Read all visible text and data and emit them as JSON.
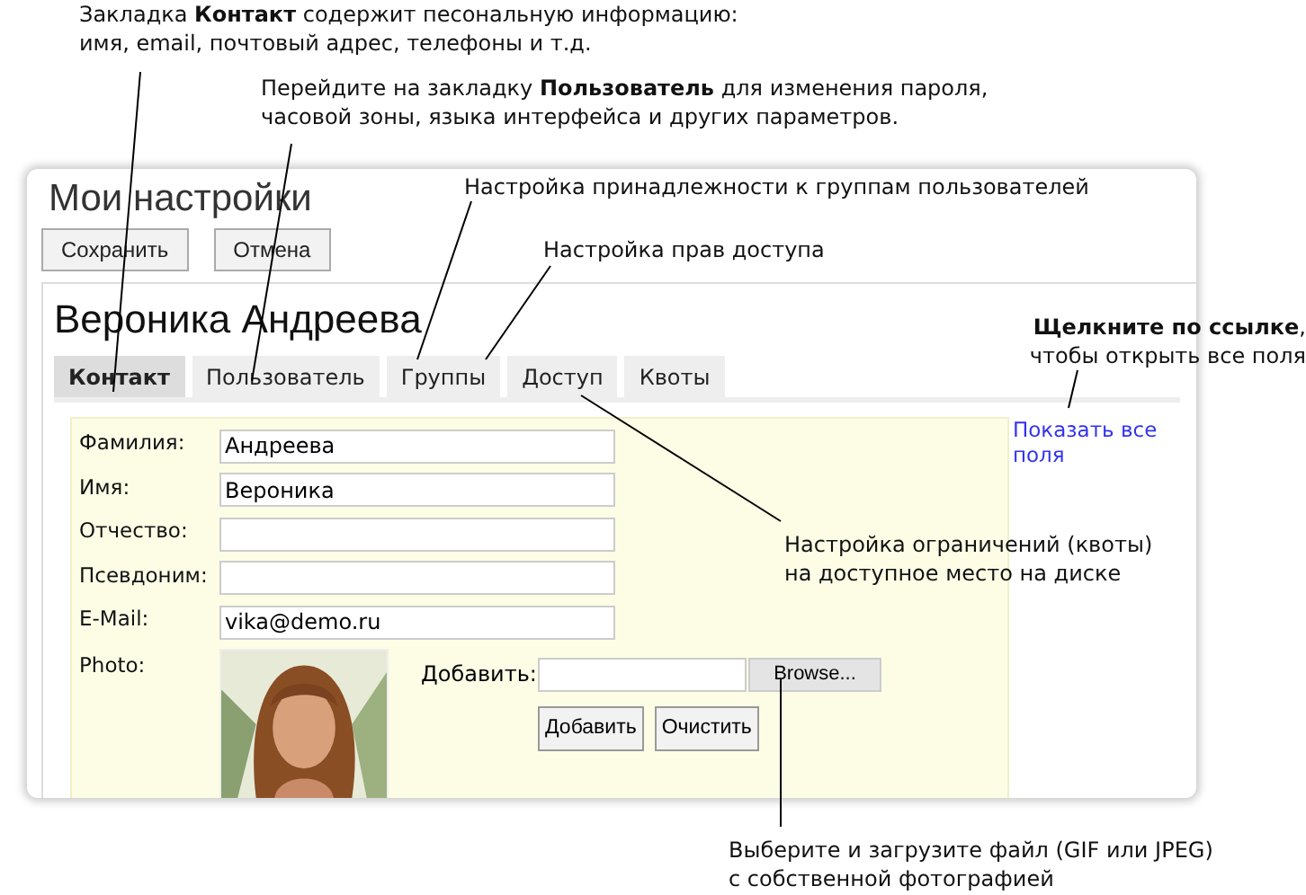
{
  "window": {
    "title": "Мои настройки",
    "buttons": [
      "Сохранить",
      "Отмена"
    ]
  },
  "profile": {
    "name": "Вероника Андреева",
    "tabs": [
      {
        "label": "Контакт",
        "selected": true
      },
      {
        "label": "Пользователь",
        "selected": false
      },
      {
        "label": "Группы",
        "selected": false
      },
      {
        "label": "Доступ",
        "selected": false
      },
      {
        "label": "Квоты",
        "selected": false
      }
    ],
    "fields": [
      {
        "label": "Фамилия:",
        "value": "Андреева"
      },
      {
        "label": "Имя:",
        "value": "Вероника"
      },
      {
        "label": "Отчество:"
      },
      {
        "label": "Псевдоним:"
      },
      {
        "label": "E-Mail:",
        "value": "vika@demo.ru"
      }
    ],
    "photo": {
      "label": "Photo:",
      "kind": "picture",
      "add_label": "Добавить:",
      "browse": "Browse...",
      "buttons": [
        "Добавить",
        "Очистить"
      ]
    },
    "show_all_link": "Показать все поля"
  },
  "callouts": [
    {
      "text": "Закладка **Контакт** содержит песональную информацию:\nимя, email, почтовый адрес, телефоны и т.д."
    },
    {
      "text": "Перейдите на закладку **Пользователь** для изменения пароля,\nчасовой зоны, языка интерфейса и других параметров."
    },
    {
      "text": "Настройка принадлежности к группам пользователей"
    },
    {
      "text": "Настройка прав доступа"
    },
    {
      "text": "**Щелкните по ссылке**,\nчтобы открыть все поля"
    },
    {
      "text": "Настройка ограничений (квоты)\nна доступное место на диске"
    },
    {
      "text": "Выберите и загрузите файл (GIF или JPEG)\nс собственной фотографией"
    }
  ]
}
